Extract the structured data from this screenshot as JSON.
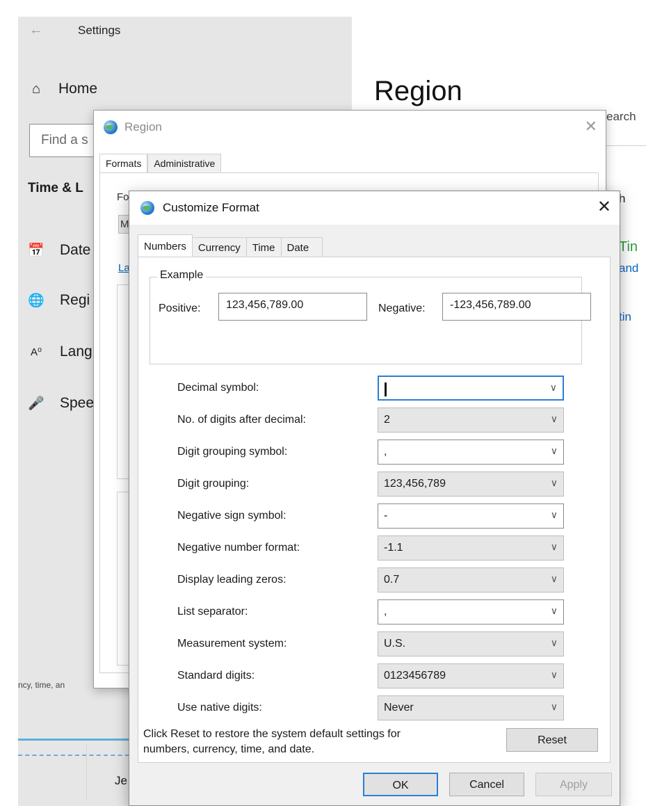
{
  "settings": {
    "title": "Settings",
    "home_label": "Home",
    "search_placeholder": "Find a s",
    "section_title": "Time & L",
    "nav_items": [
      {
        "label": "Date",
        "icon": "calendar-clock-icon"
      },
      {
        "label": "Regi",
        "icon": "globe-icon"
      },
      {
        "label": "Lang",
        "icon": "language-icon"
      },
      {
        "label": "Spee",
        "icon": "microphone-icon"
      }
    ],
    "page_heading": "Region",
    "search_stub": "earch",
    "peek_texts": [
      "h",
      "Tin",
      "and",
      "tin"
    ],
    "bottom_strip": "ncy, time, an",
    "je_text": "Je"
  },
  "region_dialog": {
    "title": "Region",
    "tabs": [
      "Formats",
      "Administrative"
    ],
    "peek_texts": [
      "Fo",
      "M",
      "La"
    ]
  },
  "customize": {
    "title": "Customize Format",
    "tabs": [
      "Numbers",
      "Currency",
      "Time",
      "Date"
    ],
    "active_tab": "Numbers",
    "example": {
      "legend": "Example",
      "positive_label": "Positive:",
      "positive_value": "123,456,789.00",
      "negative_label": "Negative:",
      "negative_value": "-123,456,789.00"
    },
    "settings": [
      {
        "label": "Decimal symbol:",
        "value": "!"
      },
      {
        "label": "No. of digits after decimal:",
        "value": "2"
      },
      {
        "label": "Digit grouping symbol:",
        "value": ","
      },
      {
        "label": "Digit grouping:",
        "value": "123,456,789"
      },
      {
        "label": "Negative sign symbol:",
        "value": "-"
      },
      {
        "label": "Negative number format:",
        "value": "-1.1"
      },
      {
        "label": "Display leading zeros:",
        "value": "0.7"
      },
      {
        "label": "List separator:",
        "value": ","
      },
      {
        "label": "Measurement system:",
        "value": "U.S."
      },
      {
        "label": "Standard digits:",
        "value": "0123456789"
      },
      {
        "label": "Use native digits:",
        "value": "Never"
      }
    ],
    "reset_note": "Click Reset to restore the system default settings for numbers, currency, time, and date.",
    "reset_button": "Reset",
    "ok_button": "OK",
    "cancel_button": "Cancel",
    "apply_button": "Apply"
  }
}
